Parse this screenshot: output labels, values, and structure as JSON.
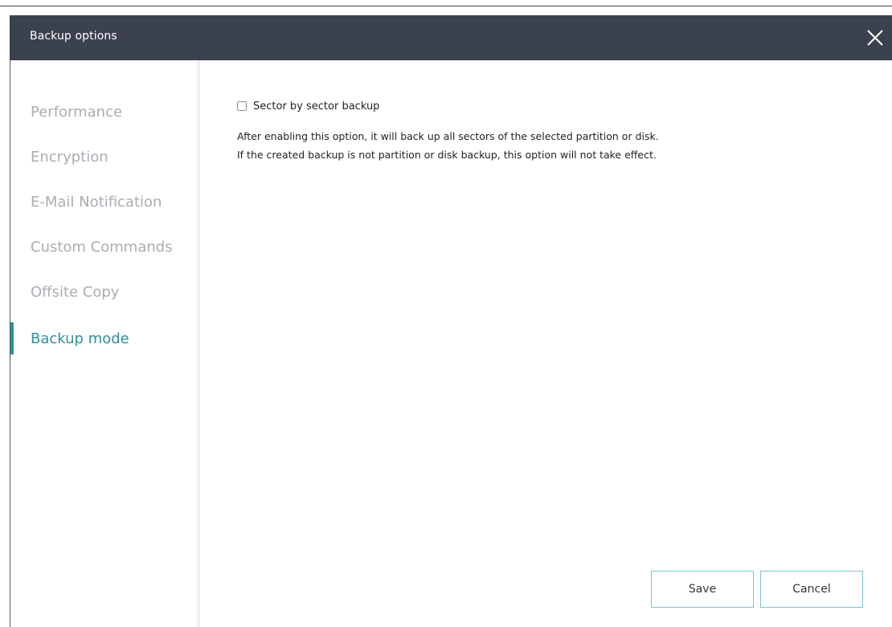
{
  "window": {
    "title": "Backup options",
    "close_icon": "close-icon"
  },
  "sidebar": {
    "accent_color": "#2f8f9e",
    "items": [
      {
        "label": "Performance",
        "active": false
      },
      {
        "label": "Encryption",
        "active": false
      },
      {
        "label": "E-Mail Notification",
        "active": false
      },
      {
        "label": "Custom Commands",
        "active": false
      },
      {
        "label": "Offsite Copy",
        "active": false
      },
      {
        "label": "Backup mode",
        "active": true
      }
    ]
  },
  "main": {
    "option": {
      "label": "Sector by sector backup",
      "checked": false
    },
    "description": {
      "line1": "After enabling this option, it will back up all sectors of the selected partition or disk.",
      "line2": "If the created backup is not partition or disk backup, this option will not take effect."
    }
  },
  "footer": {
    "save_label": "Save",
    "cancel_label": "Cancel"
  },
  "colors": {
    "title_bar": "#3c4150",
    "button_border": "#7fc3cc",
    "inactive_nav_text": "#a9adb3"
  }
}
